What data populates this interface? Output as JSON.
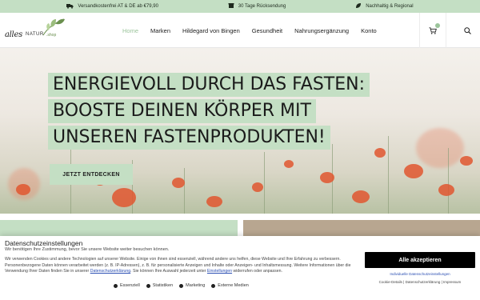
{
  "topbar": {
    "items": [
      {
        "icon": "truck-icon",
        "glyph": "🚚",
        "label": "Versandkostenfrei AT & DE ab €79,90"
      },
      {
        "icon": "return-box-icon",
        "glyph": "↺",
        "label": "30 Tage Rücksendung"
      },
      {
        "icon": "leaf-icon",
        "glyph": "❧",
        "label": "Nachhaltig & Regional"
      }
    ]
  },
  "logo": {
    "script": "alles",
    "natur": "NATUR",
    "shop": ".shop"
  },
  "nav": {
    "items": [
      "Home",
      "Marken",
      "Hildegard von Bingen",
      "Gesundheit",
      "Nahrungsergänzung",
      "Konto"
    ],
    "active": "Home"
  },
  "hero": {
    "headline_lines": [
      "ENERGIEVOLL DURCH DAS FASTEN:",
      "BOOSTE DEINEN KÖRPER MIT",
      "UNSEREN FASTENPRODUKTEN!"
    ],
    "cta": "JETZT ENTDECKEN"
  },
  "cookie": {
    "title": "Datenschutzeinstellungen",
    "subtitle": "Wir benötigen Ihre Zustimmung, bevor Sie unsere Website weiter besuchen können.",
    "body_1": "Wir verwenden Cookies und andere Technologien auf unserer Website. Einige von ihnen sind essenziell, während andere uns helfen, diese Website und Ihre Erfahrung zu verbessern. Personenbezogene Daten können verarbeitet werden (z. B. IP-Adressen), z. B. für personalisierte Anzeigen und Inhalte oder Anzeigen- und Inhaltsmessung. Weitere Informationen über die Verwendung Ihrer Daten finden Sie in unserer ",
    "link_privacy": "Datenschutzerklärung",
    "body_2": ". Sie können Ihre Auswahl jederzeit unter ",
    "link_settings": "Einstellungen",
    "body_3": " widerrufen oder anpassen.",
    "options": [
      {
        "label": "Essenziell",
        "checked": true
      },
      {
        "label": "Statistiken",
        "checked": false
      },
      {
        "label": "Marketing",
        "checked": false
      },
      {
        "label": "Externe Medien",
        "checked": false
      }
    ],
    "accept": "Alle akzeptieren",
    "individual": "Individuelle Datenschutzeinstellungen",
    "footer_links": "Cookie-Details | Datenschutzerklärung | Impressum"
  },
  "colors": {
    "accent": "#c4dfc4",
    "active_nav": "#9bc49b",
    "accept_bg": "#000000",
    "strip_right": "#b8a690"
  }
}
